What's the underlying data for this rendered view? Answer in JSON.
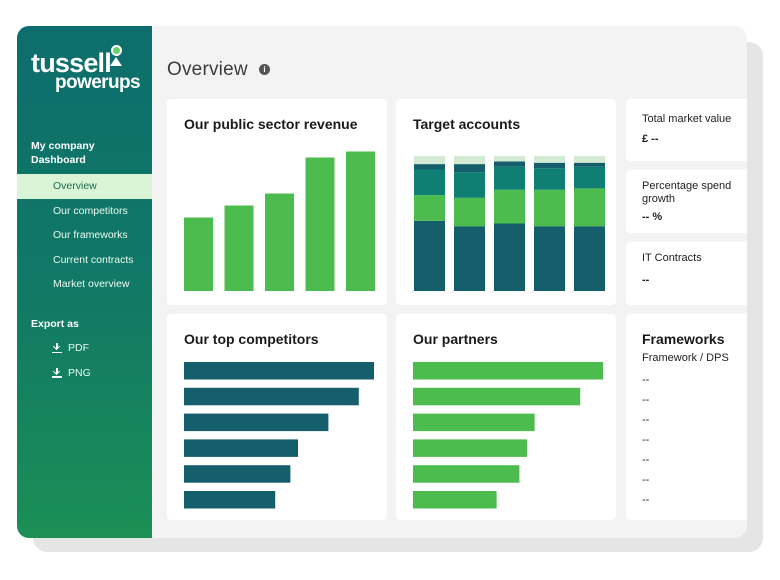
{
  "brand": {
    "name": "tussell",
    "sub": "powerups"
  },
  "sidebar": {
    "section": "My company Dashboard",
    "items": [
      {
        "label": "Overview",
        "active": true
      },
      {
        "label": "Our competitors"
      },
      {
        "label": "Our frameworks"
      },
      {
        "label": "Current contracts"
      },
      {
        "label": "Market overview"
      }
    ],
    "export_label": "Export as",
    "export_items": [
      "PDF",
      "PNG"
    ]
  },
  "main": {
    "title": "Overview",
    "info_icon": "i",
    "revenue_title": "Our public sector revenue",
    "target_title": "Target accounts",
    "competitors_title": "Our top competitors",
    "partners_title": "Our partners",
    "stats": {
      "total_market_label": "Total market value",
      "total_market_value": "£ --",
      "spend_growth_label": "Percentage spend growth",
      "spend_growth_value": "-- %",
      "it_contracts_label": "IT Contracts",
      "it_contracts_value": "--"
    },
    "frameworks": {
      "title": "Frameworks",
      "subtitle": "Framework / DPS",
      "rows": [
        "--",
        "--",
        "--",
        "--",
        "--",
        "--",
        "--"
      ]
    }
  },
  "colors": {
    "green": "#4cbc4e",
    "dark_teal": "#155e6b",
    "mid_teal": "#0f7f74",
    "light_green": "#d2ebd2"
  },
  "chart_data": [
    {
      "type": "bar",
      "categories": [
        "1",
        "2",
        "3",
        "4",
        "5"
      ],
      "values": [
        0.49,
        0.57,
        0.65,
        0.89,
        0.93
      ]
    },
    {
      "type": "bar",
      "categories": [
        "1",
        "2",
        "3",
        "4",
        "5"
      ],
      "series": [
        {
          "values": [
            0.52,
            0.48,
            0.5,
            0.48,
            0.48
          ]
        },
        {
          "values": [
            0.19,
            0.21,
            0.25,
            0.27,
            0.28
          ]
        },
        {
          "values": [
            0.19,
            0.19,
            0.17,
            0.16,
            0.16
          ]
        },
        {
          "values": [
            0.04,
            0.06,
            0.04,
            0.04,
            0.03
          ]
        },
        {
          "values": [
            0.06,
            0.06,
            0.04,
            0.05,
            0.05
          ]
        }
      ]
    },
    {
      "type": "bar",
      "categories": [
        "1",
        "2",
        "3",
        "4",
        "5",
        "6"
      ],
      "values": [
        1.0,
        0.92,
        0.76,
        0.6,
        0.56,
        0.48
      ]
    },
    {
      "type": "bar",
      "categories": [
        "1",
        "2",
        "3",
        "4",
        "5",
        "6"
      ],
      "values": [
        1.0,
        0.88,
        0.64,
        0.6,
        0.56,
        0.44
      ]
    }
  ]
}
